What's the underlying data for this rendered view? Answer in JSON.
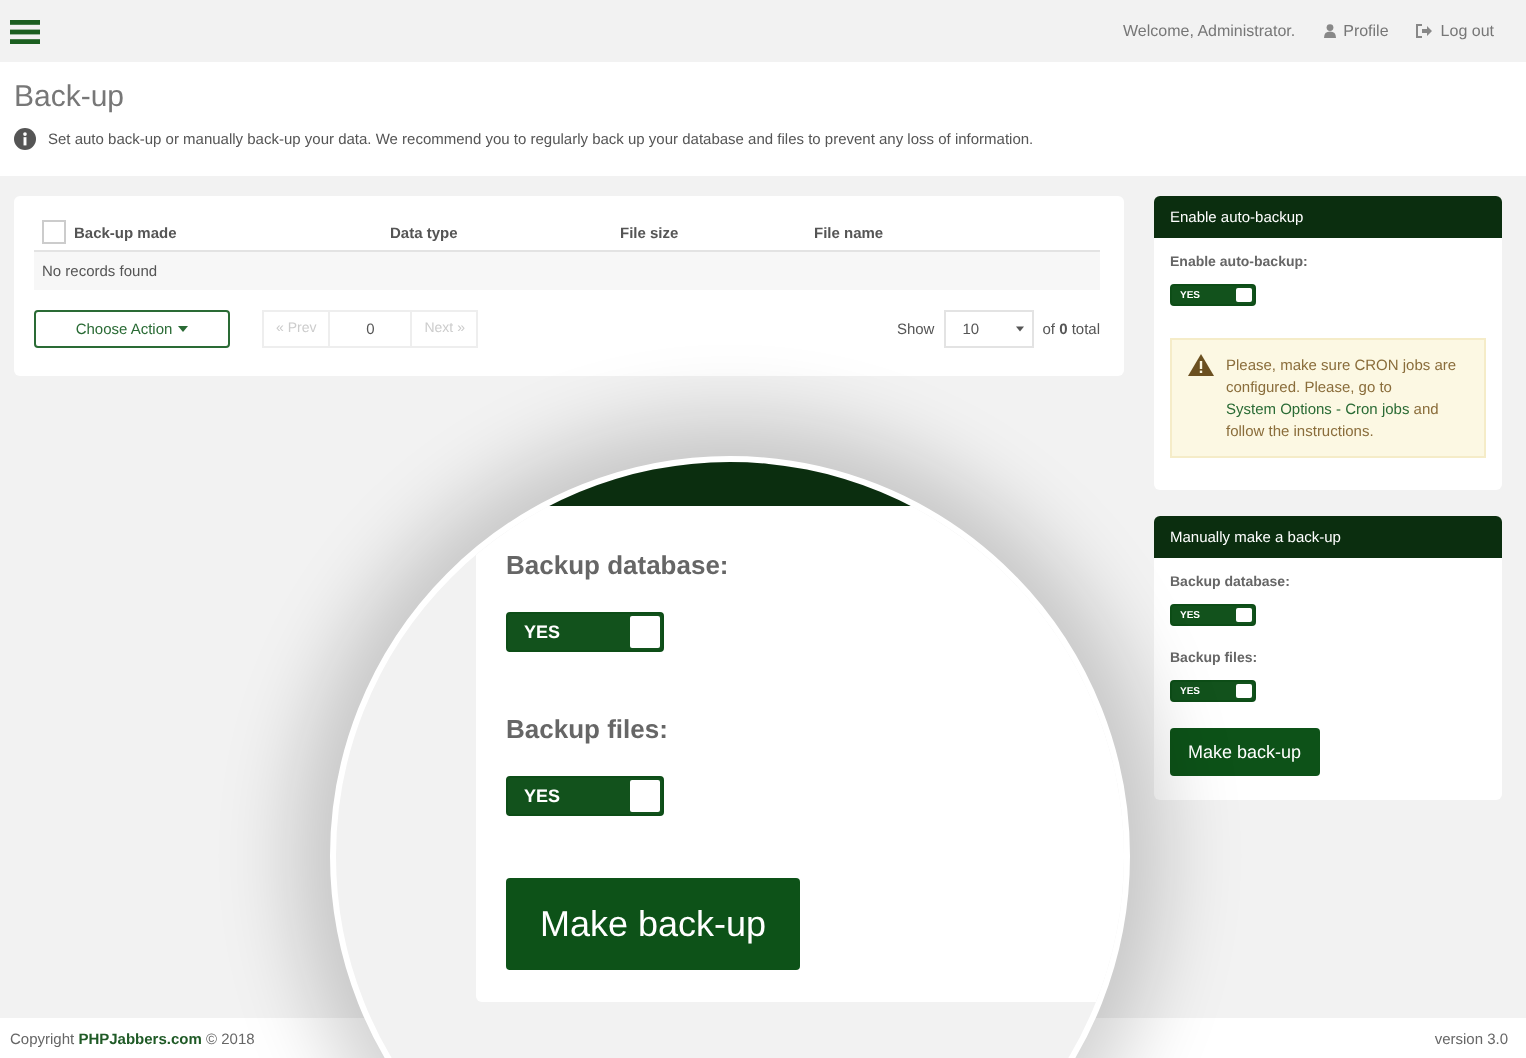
{
  "header": {
    "welcome": "Welcome, Administrator.",
    "profile": "Profile",
    "logout": "Log out"
  },
  "page": {
    "title": "Back-up",
    "intro": "Set auto back-up or manually back-up your data. We recommend you to regularly back up your database and files to prevent any loss of information."
  },
  "table": {
    "select_all": {
      "checked": false
    },
    "columns": [
      "Back-up made",
      "Data type",
      "File size",
      "File name"
    ],
    "empty_text": "No records found",
    "action_button": "Choose Action",
    "pager": {
      "prev": "« Prev",
      "page": "0",
      "next": "Next »"
    },
    "show_label": "Show",
    "per_page": "10",
    "total": "of **0** total"
  },
  "auto_backup": {
    "title": "Enable auto-backup",
    "label": "Enable auto-backup:",
    "toggle": {
      "label": "YES",
      "on": true
    },
    "warning": {
      "before": "Please, make sure CRON jobs are configured. Please, go to",
      "link": "System Options - Cron jobs",
      "after": "and follow the instructions."
    }
  },
  "manual": {
    "title": "Manually make a back-up",
    "fields": [
      {
        "label": "Backup database:",
        "toggle": {
          "label": "YES",
          "on": true
        }
      },
      {
        "label": "Backup files:",
        "toggle": {
          "label": "YES",
          "on": true
        }
      }
    ],
    "button": "Make back-up"
  },
  "magnifier": {
    "fields": [
      {
        "label": "Backup database:",
        "toggle": {
          "label": "YES",
          "on": true
        }
      },
      {
        "label": "Backup files:",
        "toggle": {
          "label": "YES",
          "on": true
        }
      }
    ],
    "button": "Make back-up"
  },
  "footer": {
    "copyright_before": "Copyright",
    "brand": "PHPJabbers.com",
    "copyright_after": "© 2018",
    "version": "version 3.0"
  }
}
